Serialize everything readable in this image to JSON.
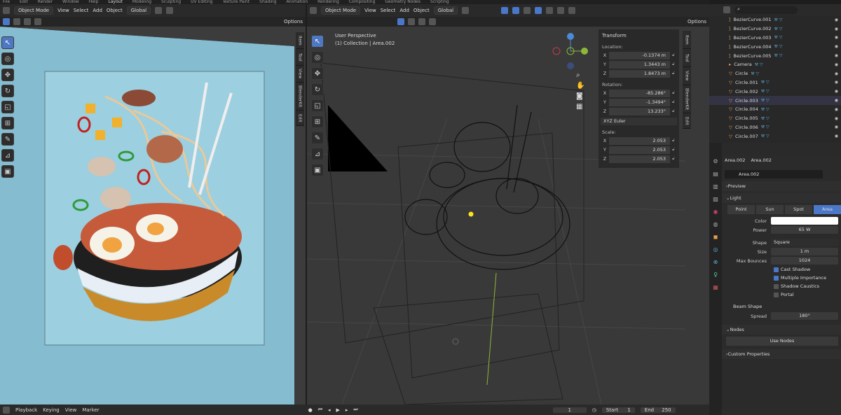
{
  "topbar": [
    "File",
    "Edit",
    "Render",
    "Window",
    "Help",
    "Layout",
    "Modeling",
    "Sculpting",
    "UV Editing",
    "Texture Paint",
    "Shading",
    "Animation",
    "Rendering",
    "Compositing",
    "Geometry Nodes",
    "Scripting"
  ],
  "left_view": {
    "mode": "Object Mode",
    "menus": [
      "View",
      "Select",
      "Add",
      "Object"
    ],
    "orientation": "Global",
    "options": "Options",
    "tabs": [
      "Item",
      "Tool",
      "View",
      "BlenderKit",
      "Edit"
    ]
  },
  "right_view": {
    "mode": "Object Mode",
    "menus": [
      "View",
      "Select",
      "Add",
      "Object"
    ],
    "orientation": "Global",
    "options": "Options",
    "perspective": "User Perspective",
    "collection": "(1) Collection | Area.002",
    "tabs": [
      "Item",
      "Tool",
      "View",
      "BlenderKit",
      "Edit"
    ]
  },
  "transform": {
    "title": "Transform",
    "location_label": "Location:",
    "location": [
      {
        "axis": "X",
        "value": "-0.1374 m"
      },
      {
        "axis": "Y",
        "value": "1.3443 m"
      },
      {
        "axis": "Z",
        "value": "1.8473 m"
      }
    ],
    "rotation_label": "Rotation:",
    "rotation": [
      {
        "axis": "X",
        "value": "-85.286°"
      },
      {
        "axis": "Y",
        "value": "-1.3494°"
      },
      {
        "axis": "Z",
        "value": "13.233°"
      }
    ],
    "euler": "XYZ Euler",
    "scale_label": "Scale:",
    "scale": [
      {
        "axis": "X",
        "value": "2.053"
      },
      {
        "axis": "Y",
        "value": "2.053"
      },
      {
        "axis": "Z",
        "value": "2.053"
      }
    ]
  },
  "outliner": [
    "BezierCurve.001",
    "BezierCurve.002",
    "BezierCurve.003",
    "BezierCurve.004",
    "BezierCurve.005",
    "Camera",
    "Circle",
    "Circle.001",
    "Circle.002",
    "Circle.003",
    "Circle.004",
    "Circle.005",
    "Circle.006",
    "Circle.007"
  ],
  "properties": {
    "object": "Area.002",
    "data": "Area.002",
    "datablock": "Area.002",
    "preview": "Preview",
    "light": "Light",
    "types": [
      "Point",
      "Sun",
      "Spot",
      "Area"
    ],
    "color_label": "Color",
    "power_label": "Power",
    "power": "65 W",
    "shape_label": "Shape",
    "shape": "Square",
    "size_label": "Size",
    "size": "1 m",
    "bounces_label": "Max Bounces",
    "bounces": "1024",
    "cast_shadow": "Cast Shadow",
    "mis": "Multiple Importance",
    "caustics": "Shadow Caustics",
    "portal": "Portal",
    "beam": "Beam Shape",
    "spread_label": "Spread",
    "spread": "180°",
    "nodes": "Nodes",
    "use_nodes": "Use Nodes",
    "custom": "Custom Properties"
  },
  "timeline": {
    "playback": "Playback",
    "keying": "Keying",
    "view": "View",
    "marker": "Marker",
    "frame": "1",
    "start_label": "Start",
    "start": "1",
    "end_label": "End",
    "end": "250"
  },
  "colors": {
    "accent": "#4b77c9",
    "poster_bg": "#9ccfdf"
  }
}
